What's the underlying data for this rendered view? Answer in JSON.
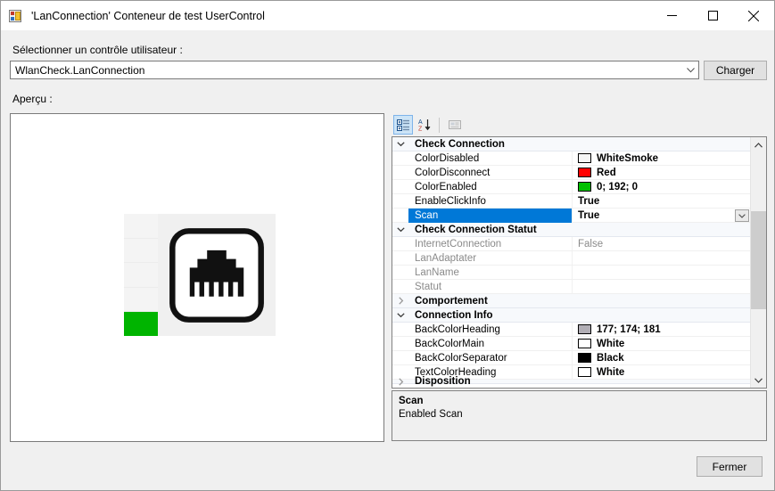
{
  "window": {
    "title": "'LanConnection' Conteneur de test UserControl",
    "icon": "usercontrol-icon",
    "buttons": {
      "minimize": "minimize-icon",
      "maximize": "maximize-icon",
      "close": "close-icon"
    }
  },
  "form": {
    "select_label": "Sélectionner un contrôle utilisateur :",
    "combo_value": "WlanCheck.LanConnection",
    "load_button": "Charger",
    "preview_label": "Aperçu :",
    "close_button": "Fermer"
  },
  "preview": {
    "control_icon": "rj45-lan-connector-icon",
    "status_color": "#00b400",
    "panel_bg": "#f0f0f0"
  },
  "property_grid": {
    "toolbar": {
      "categorized": "categorized-view-icon",
      "alphabetical": "alphabetical-sort-icon",
      "property_pages": "property-pages-icon"
    },
    "selected_property": "Scan",
    "rows": [
      {
        "kind": "category",
        "expanded": true,
        "name": "Check Connection"
      },
      {
        "kind": "property",
        "name": "ColorDisabled",
        "value": "WhiteSmoke",
        "swatch": "#f5f5f5",
        "bold": true
      },
      {
        "kind": "property",
        "name": "ColorDisconnect",
        "value": "Red",
        "swatch": "#ff0000",
        "bold": true
      },
      {
        "kind": "property",
        "name": "ColorEnabled",
        "value": "0; 192; 0",
        "swatch": "#00c000",
        "bold": true
      },
      {
        "kind": "property",
        "name": "EnableClickInfo",
        "value": "True",
        "bold": true
      },
      {
        "kind": "property",
        "name": "Scan",
        "value": "True",
        "bold": true,
        "selected": true,
        "editor": "dropdown"
      },
      {
        "kind": "category",
        "expanded": true,
        "name": "Check Connection Statut"
      },
      {
        "kind": "property",
        "name": "InternetConnection",
        "value": "False",
        "readonly": true
      },
      {
        "kind": "property",
        "name": "LanAdaptater",
        "value": "",
        "readonly": true
      },
      {
        "kind": "property",
        "name": "LanName",
        "value": "",
        "readonly": true
      },
      {
        "kind": "property",
        "name": "Statut",
        "value": "",
        "readonly": true
      },
      {
        "kind": "category",
        "expanded": false,
        "name": "Comportement"
      },
      {
        "kind": "category",
        "expanded": true,
        "name": "Connection Info"
      },
      {
        "kind": "property",
        "name": "BackColorHeading",
        "value": "177; 174; 181",
        "swatch": "#b1aeb5",
        "bold": true
      },
      {
        "kind": "property",
        "name": "BackColorMain",
        "value": "White",
        "swatch": "#ffffff",
        "bold": true
      },
      {
        "kind": "property",
        "name": "BackColorSeparator",
        "value": "Black",
        "swatch": "#000000",
        "bold": true
      },
      {
        "kind": "property",
        "name": "TextColorHeading",
        "value": "White",
        "swatch": "#ffffff",
        "bold": true
      },
      {
        "kind": "category",
        "expanded": false,
        "name": "Disposition",
        "clipped": true
      }
    ],
    "description": {
      "title": "Scan",
      "text": "Enabled Scan"
    }
  },
  "colors": {
    "selection": "#0078d7",
    "window_bg": "#f0f0f0",
    "grid_bg": "#ffffff",
    "category_bg": "#f7f9fc"
  }
}
